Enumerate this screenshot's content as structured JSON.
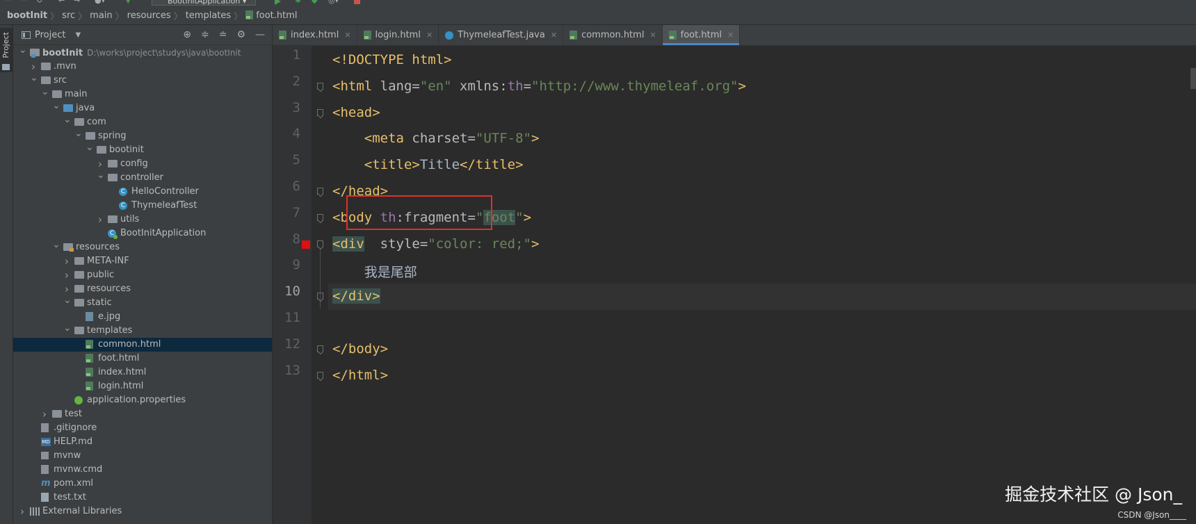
{
  "toolbar": {
    "run_config": "BootInitApplication"
  },
  "breadcrumb": [
    "bootInit",
    "src",
    "main",
    "resources",
    "templates",
    "foot.html"
  ],
  "side_stripe": {
    "project_label": "Project"
  },
  "project_panel": {
    "title": "Project",
    "tree": [
      {
        "label": "bootInit",
        "path": "D:\\works\\project\\studys\\java\\bootInit",
        "depth": 0,
        "arrow": "open",
        "icon": "module-folder-icon"
      },
      {
        "label": ".mvn",
        "depth": 1,
        "arrow": "closed",
        "icon": "folder-icon"
      },
      {
        "label": "src",
        "depth": 1,
        "arrow": "open",
        "icon": "folder-icon"
      },
      {
        "label": "main",
        "depth": 2,
        "arrow": "open",
        "icon": "folder-icon"
      },
      {
        "label": "java",
        "depth": 3,
        "arrow": "open",
        "icon": "source-folder-icon"
      },
      {
        "label": "com",
        "depth": 4,
        "arrow": "open",
        "icon": "package-icon"
      },
      {
        "label": "spring",
        "depth": 5,
        "arrow": "open",
        "icon": "package-icon"
      },
      {
        "label": "bootinit",
        "depth": 6,
        "arrow": "open",
        "icon": "package-icon"
      },
      {
        "label": "config",
        "depth": 7,
        "arrow": "closed",
        "icon": "package-icon"
      },
      {
        "label": "controller",
        "depth": 7,
        "arrow": "open",
        "icon": "package-icon"
      },
      {
        "label": "HelloController",
        "depth": 8,
        "arrow": "none",
        "icon": "java-class-icon"
      },
      {
        "label": "ThymeleafTest",
        "depth": 8,
        "arrow": "none",
        "icon": "java-class-icon"
      },
      {
        "label": "utils",
        "depth": 7,
        "arrow": "closed",
        "icon": "package-icon"
      },
      {
        "label": "BootInitApplication",
        "depth": 7,
        "arrow": "none",
        "icon": "spring-app-icon"
      },
      {
        "label": "resources",
        "depth": 3,
        "arrow": "open",
        "icon": "resources-folder-icon"
      },
      {
        "label": "META-INF",
        "depth": 4,
        "arrow": "closed",
        "icon": "folder-icon"
      },
      {
        "label": "public",
        "depth": 4,
        "arrow": "closed",
        "icon": "folder-icon"
      },
      {
        "label": "resources",
        "depth": 4,
        "arrow": "closed",
        "icon": "folder-icon"
      },
      {
        "label": "static",
        "depth": 4,
        "arrow": "open",
        "icon": "folder-icon"
      },
      {
        "label": "e.jpg",
        "depth": 5,
        "arrow": "none",
        "icon": "image-file-icon"
      },
      {
        "label": "templates",
        "depth": 4,
        "arrow": "open",
        "icon": "folder-icon"
      },
      {
        "label": "common.html",
        "depth": 5,
        "arrow": "none",
        "icon": "html-file-icon",
        "selected": true
      },
      {
        "label": "foot.html",
        "depth": 5,
        "arrow": "none",
        "icon": "html-file-icon"
      },
      {
        "label": "index.html",
        "depth": 5,
        "arrow": "none",
        "icon": "html-file-icon"
      },
      {
        "label": "login.html",
        "depth": 5,
        "arrow": "none",
        "icon": "html-file-icon"
      },
      {
        "label": "application.properties",
        "depth": 4,
        "arrow": "none",
        "icon": "properties-file-icon"
      },
      {
        "label": "test",
        "depth": 2,
        "arrow": "closed",
        "icon": "folder-icon"
      },
      {
        "label": ".gitignore",
        "depth": 1,
        "arrow": "none",
        "icon": "gitignore-file-icon"
      },
      {
        "label": "HELP.md",
        "depth": 1,
        "arrow": "none",
        "icon": "markdown-file-icon"
      },
      {
        "label": "mvnw",
        "depth": 1,
        "arrow": "none",
        "icon": "shell-file-icon"
      },
      {
        "label": "mvnw.cmd",
        "depth": 1,
        "arrow": "none",
        "icon": "cmd-file-icon"
      },
      {
        "label": "pom.xml",
        "depth": 1,
        "arrow": "none",
        "icon": "maven-pom-icon"
      },
      {
        "label": "test.txt",
        "depth": 1,
        "arrow": "none",
        "icon": "text-file-icon"
      },
      {
        "label": "External Libraries",
        "depth": 0,
        "arrow": "closed",
        "icon": "libraries-icon"
      }
    ]
  },
  "tabs": [
    {
      "label": "index.html",
      "icon": "html-file-icon",
      "active": false
    },
    {
      "label": "login.html",
      "icon": "html-file-icon",
      "active": false
    },
    {
      "label": "ThymeleafTest.java",
      "icon": "java-class-icon",
      "active": false
    },
    {
      "label": "common.html",
      "icon": "html-file-icon",
      "active": false
    },
    {
      "label": "foot.html",
      "icon": "html-file-icon",
      "active": true
    }
  ],
  "editor": {
    "current_line": 10,
    "line_numbers": [
      "1",
      "2",
      "3",
      "4",
      "5",
      "6",
      "7",
      "8",
      "9",
      "10",
      "11",
      "12",
      "13"
    ],
    "lines": [
      [
        {
          "t": "<!DOCTYPE html>",
          "c": "t"
        }
      ],
      [
        {
          "t": "<html ",
          "c": "t"
        },
        {
          "t": "lang=",
          "c": "a"
        },
        {
          "t": "\"en\" ",
          "c": "v"
        },
        {
          "t": "xmlns:",
          "c": "a"
        },
        {
          "t": "th",
          "c": "ns"
        },
        {
          "t": "=",
          "c": "a"
        },
        {
          "t": "\"http://www.thymeleaf.org\"",
          "c": "v"
        },
        {
          "t": ">",
          "c": "t"
        }
      ],
      [
        {
          "t": "<head>",
          "c": "t"
        }
      ],
      [
        {
          "t": "    <meta ",
          "c": "t"
        },
        {
          "t": "charset=",
          "c": "a"
        },
        {
          "t": "\"UTF-8\"",
          "c": "v"
        },
        {
          "t": ">",
          "c": "t"
        }
      ],
      [
        {
          "t": "    <title>",
          "c": "t"
        },
        {
          "t": "Title",
          "c": "txt"
        },
        {
          "t": "</title>",
          "c": "t"
        }
      ],
      [
        {
          "t": "</head>",
          "c": "t"
        }
      ],
      [
        {
          "t": "<body ",
          "c": "t"
        },
        {
          "t": "th",
          "c": "ns"
        },
        {
          "t": ":fragment=",
          "c": "a"
        },
        {
          "t": "\"",
          "c": "v"
        },
        {
          "t": "foot",
          "c": "v hl"
        },
        {
          "t": "\"",
          "c": "v"
        },
        {
          "t": ">",
          "c": "t"
        }
      ],
      [
        {
          "t": "<div",
          "c": "t hl"
        },
        {
          "t": "  style=",
          "c": "a"
        },
        {
          "t": "\"color: red;\"",
          "c": "v"
        },
        {
          "t": ">",
          "c": "t"
        }
      ],
      [
        {
          "t": "    我是尾部",
          "c": "txt"
        }
      ],
      [
        {
          "t": "</div>",
          "c": "t hl"
        }
      ],
      [],
      [
        {
          "t": "</body>",
          "c": "t"
        }
      ],
      [
        {
          "t": "</html>",
          "c": "t"
        }
      ]
    ]
  },
  "watermark": {
    "main": "掘金技术社区 @ Json_",
    "sub": "CSDN @Json____"
  }
}
